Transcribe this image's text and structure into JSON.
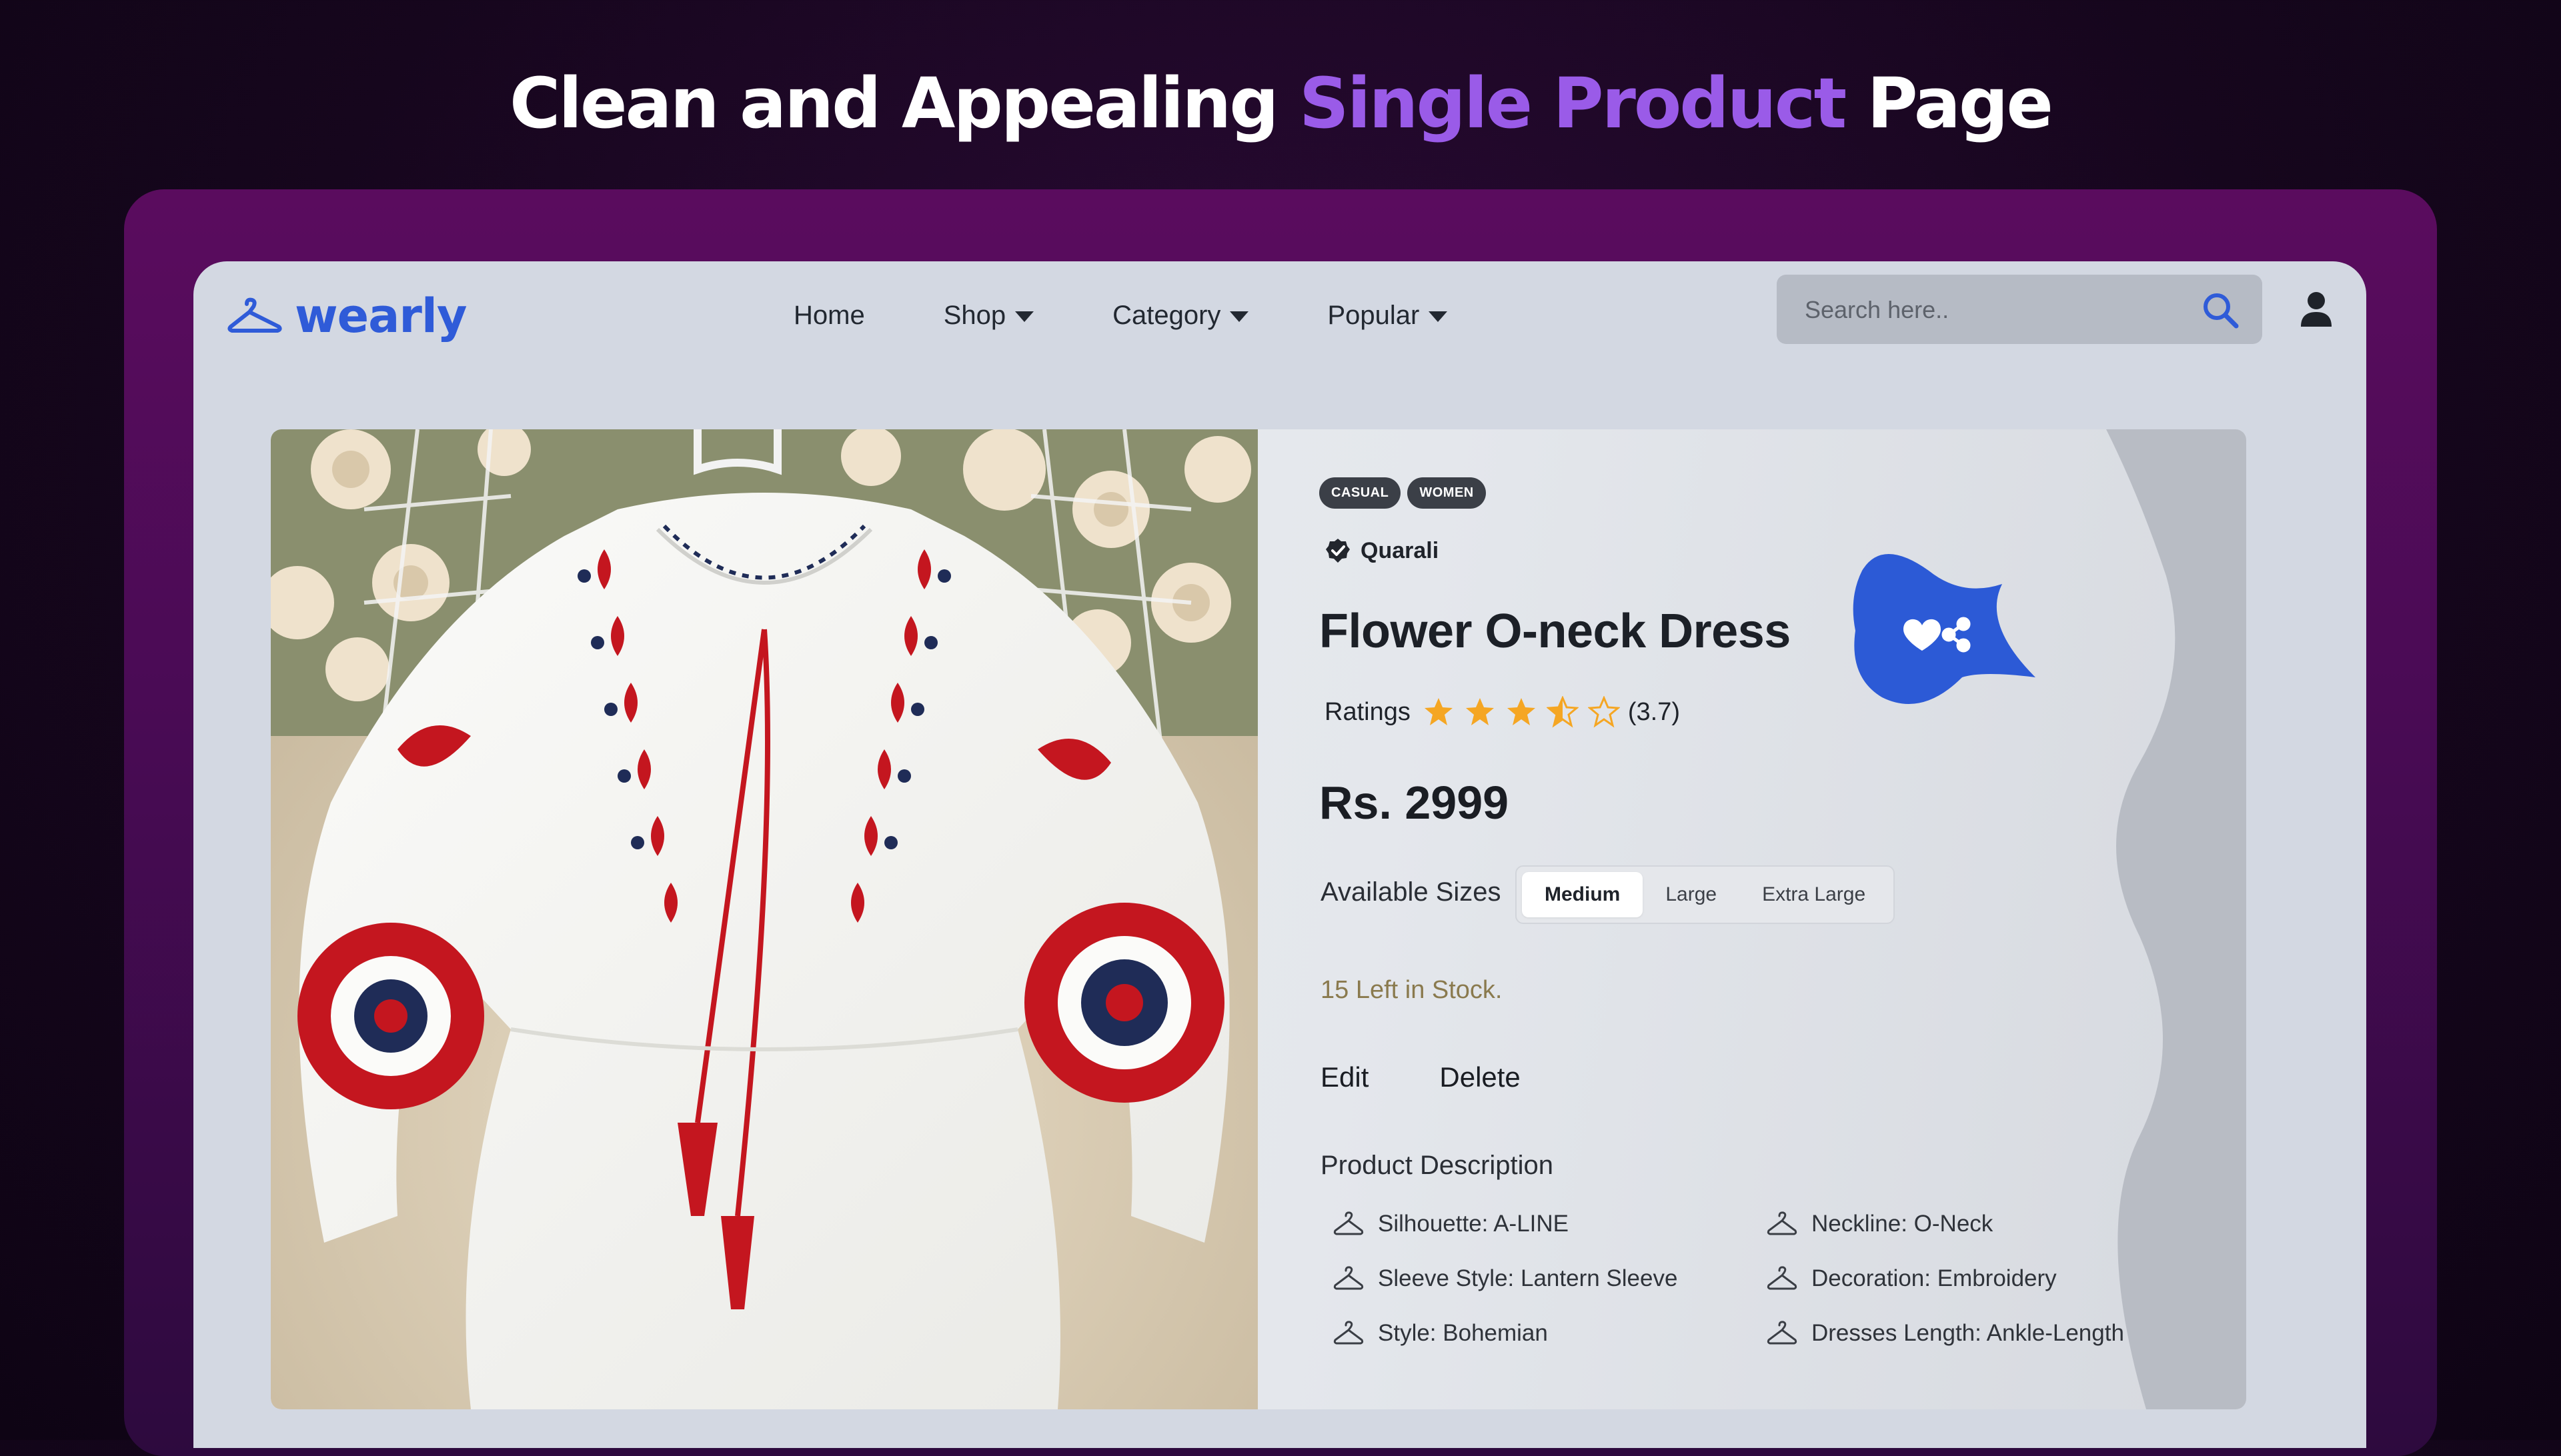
{
  "headline": {
    "part1": "Clean and Appealing ",
    "accent": "Single Product",
    "part2": " Page"
  },
  "brand": {
    "name": "wearly",
    "color": "#2f5bd8"
  },
  "nav": {
    "items": [
      {
        "label": "Home",
        "dropdown": false
      },
      {
        "label": "Shop",
        "dropdown": true
      },
      {
        "label": "Category",
        "dropdown": true
      },
      {
        "label": "Popular",
        "dropdown": true
      }
    ]
  },
  "search": {
    "placeholder": "Search here..",
    "icon": "search-icon"
  },
  "user": {
    "icon": "user-icon"
  },
  "product": {
    "tags": [
      "CASUAL",
      "WOMEN"
    ],
    "seller": "Quarali",
    "seller_icon": "verified-badge-icon",
    "title": "Flower O-neck Dress",
    "ratings_label": "Ratings",
    "rating_value": 3.7,
    "rating_text": "(3.7)",
    "price": "Rs. 2999",
    "sizes_label": "Available Sizes",
    "sizes": [
      "Medium",
      "Large",
      "Extra Large"
    ],
    "selected_size": "Medium",
    "stock": "15 Left in Stock.",
    "edit_label": "Edit",
    "delete_label": "Delete",
    "description_title": "Product Description",
    "attributes": [
      "Silhouette: A-LINE",
      "Neckline: O-Neck",
      "Sleeve Style: Lantern Sleeve",
      "Decoration: Embroidery",
      "Style: Bohemian",
      "Dresses Length: Ankle-Length"
    ],
    "attribute_icon": "hanger-icon",
    "actions_icons": [
      "heart-icon",
      "share-icon"
    ]
  },
  "colors": {
    "accent": "#9a5be8",
    "brand_blue": "#2f5bd8",
    "star": "#f5a623",
    "stock_text": "#8a7a4e"
  }
}
